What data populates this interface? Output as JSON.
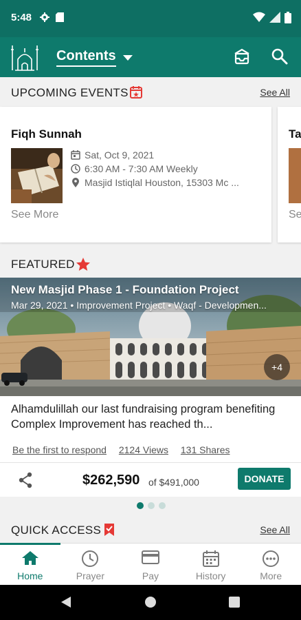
{
  "status_bar": {
    "time": "5:48"
  },
  "app_bar": {
    "title": "Contents"
  },
  "upcoming": {
    "heading": "UPCOMING EVENTS",
    "see_all": "See All",
    "event": {
      "title": "Fiqh Sunnah",
      "date": "Sat, Oct 9, 2021",
      "time": "6:30 AM - 7:30 AM Weekly",
      "location": "Masjid Istiqlal Houston, 15303 Mc ...",
      "see_more": "See More"
    },
    "next_peek": {
      "title": "Ta",
      "see_more": "Se"
    }
  },
  "featured": {
    "heading": "FEATURED",
    "title": "New Masjid Phase 1 - Foundation Project",
    "date": "Mar 29, 2021",
    "category": "Improvement Project",
    "tag": "Waqf - Developmen...",
    "more_images": "+4",
    "description": "Alhamdulillah our last fundraising program benefiting Complex Improvement has reached th...",
    "respond": "Be the first to respond",
    "views": "2124 Views",
    "shares": "131 Shares",
    "raised": "$262,590",
    "goal": "of $491,000",
    "donate_label": "DONATE",
    "carousel_position": 1,
    "carousel_count": 3
  },
  "quick_access": {
    "heading": "QUICK ACCESS",
    "see_all": "See All"
  },
  "bottom_nav": {
    "home": "Home",
    "prayer": "Prayer",
    "pay": "Pay",
    "history": "History",
    "more": "More"
  },
  "colors": {
    "primary": "#0e7a6c",
    "status_bar": "#0e6f63",
    "accent_red": "#e53935"
  }
}
